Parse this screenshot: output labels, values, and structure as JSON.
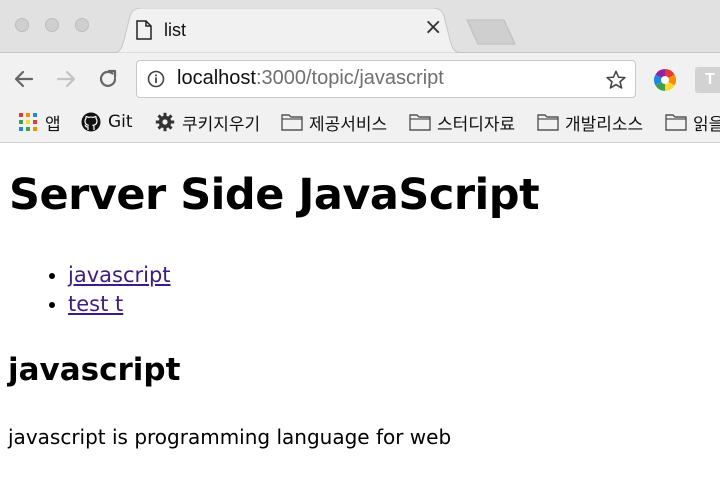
{
  "window": {
    "traffic_lights": [
      "close",
      "minimize",
      "zoom"
    ]
  },
  "tab": {
    "title": "list",
    "close_label": "×"
  },
  "toolbar": {
    "url_host": "localhost",
    "url_rest": ":3000/topic/javascript",
    "extension_t_label": "T"
  },
  "bookmarks": {
    "items": [
      {
        "label": "앱",
        "icon": "apps-grid-icon"
      },
      {
        "label": "Git",
        "icon": "github-icon"
      },
      {
        "label": "쿠키지우기",
        "icon": "gear-icon"
      },
      {
        "label": "제공서비스",
        "icon": "folder-icon"
      },
      {
        "label": "스터디자료",
        "icon": "folder-icon"
      },
      {
        "label": "개발리소스",
        "icon": "folder-icon"
      },
      {
        "label": "읽을",
        "icon": "folder-icon"
      }
    ]
  },
  "page": {
    "heading": "Server Side JavaScript",
    "links": [
      "javascript",
      "test t"
    ],
    "subheading": "javascript",
    "description": "javascript is programming language for web"
  },
  "colors": {
    "link": "#3d1b8a",
    "tabstrip": "#e1e1e1",
    "toolbar": "#f1f1f1"
  }
}
